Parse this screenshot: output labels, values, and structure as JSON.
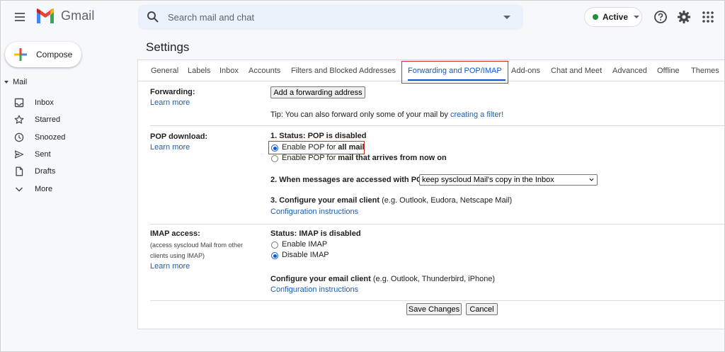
{
  "app": {
    "name": "Gmail"
  },
  "search": {
    "placeholder": "Search mail and chat"
  },
  "status": {
    "label": "Active",
    "color": "#1e8e3e"
  },
  "sidebar": {
    "compose_label": "Compose",
    "mail_heading": "Mail",
    "items": [
      {
        "label": "Inbox",
        "icon": "inbox-icon"
      },
      {
        "label": "Starred",
        "icon": "star-icon"
      },
      {
        "label": "Snoozed",
        "icon": "clock-icon"
      },
      {
        "label": "Sent",
        "icon": "send-icon"
      },
      {
        "label": "Drafts",
        "icon": "draft-icon"
      },
      {
        "label": "More",
        "icon": "chevron-down-icon"
      }
    ]
  },
  "settings": {
    "title": "Settings",
    "tabs": [
      "General",
      "Labels",
      "Inbox",
      "Accounts",
      "Filters and Blocked Addresses",
      "Forwarding and POP/IMAP",
      "Add-ons",
      "Chat and Meet",
      "Advanced",
      "Offline",
      "Themes"
    ],
    "active_tab": "Forwarding and POP/IMAP",
    "forwarding": {
      "label": "Forwarding:",
      "learn_more": "Learn more",
      "add_button": "Add a forwarding address",
      "tip_prefix": "Tip: You can also forward only some of your mail by ",
      "tip_link": "creating a filter!"
    },
    "pop": {
      "label": "POP download:",
      "learn_more": "Learn more",
      "status": "1. Status: POP is disabled",
      "option1_prefix": "Enable POP for ",
      "option1_bold": "all mail",
      "option2_prefix": "Enable POP for ",
      "option2_bold": "mail that arrives from now on",
      "selected_option": 1,
      "accessed_label": "2. When messages are accessed with POP",
      "accessed_value": "keep syscloud Mail's copy in the Inbox",
      "configure_bold": "3. Configure your email client",
      "configure_rest": " (e.g. Outlook, Eudora, Netscape Mail)",
      "config_link": "Configuration instructions"
    },
    "imap": {
      "label": "IMAP access:",
      "desc_line1": "(access syscloud Mail from other",
      "desc_line2": "clients using IMAP)",
      "learn_more": "Learn more",
      "status": "Status: IMAP is disabled",
      "option_enable": "Enable IMAP",
      "option_disable": "Disable IMAP",
      "selected": "disable",
      "configure_bold": "Configure your email client",
      "configure_rest": " (e.g. Outlook, Thunderbird, iPhone)",
      "config_link": "Configuration instructions"
    },
    "save_label": "Save Changes",
    "cancel_label": "Cancel"
  },
  "colors": {
    "highlight": "#d93025",
    "link": "#1a5fb4",
    "active_tab": "#0b57d0"
  }
}
